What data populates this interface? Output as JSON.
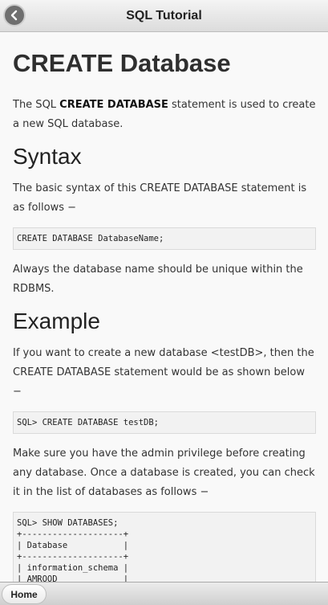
{
  "header": {
    "title": "SQL Tutorial",
    "back_icon": "back-arrow-icon"
  },
  "main": {
    "title": "CREATE Database",
    "intro": {
      "pre": "The SQL ",
      "bold": "CREATE DATABASE",
      "post": " statement is used to create a new SQL database."
    },
    "syntax_heading": "Syntax",
    "syntax_text": "The basic syntax of this CREATE DATABASE statement is as follows −",
    "syntax_code": "CREATE DATABASE DatabaseName;",
    "unique_text": "Always the database name should be unique within the RDBMS.",
    "example_heading": "Example",
    "example_text": "If you want to create a new database <testDB>, then the CREATE DATABASE statement would be as shown below −",
    "example_code": "SQL> CREATE DATABASE testDB;",
    "privilege_text": "Make sure you have the admin privilege before creating any database. Once a database is created, you can check it in the list of databases as follows −",
    "show_code": "SQL> SHOW DATABASES;\n+--------------------+\n| Database           |\n+--------------------+\n| information_schema |\n| AMROOD             |\n| TUTORIALSPOINT     |"
  },
  "footer": {
    "home_label": "Home"
  }
}
